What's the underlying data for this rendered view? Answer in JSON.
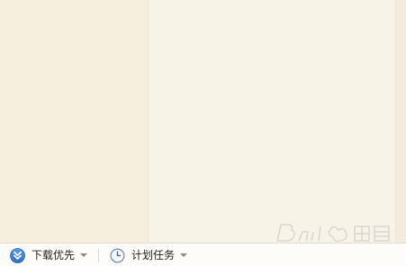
{
  "statusbar": {
    "download_priority": {
      "label": "下载优先",
      "icon": "double-chevron-down-icon"
    },
    "scheduled_task": {
      "label": "计划任务",
      "icon": "clock-icon"
    }
  },
  "watermark": {
    "icon": "baidu-jingyan-watermark"
  },
  "colors": {
    "left_pane": "#f7efde",
    "main_pane": "#f8f3e7",
    "statusbar": "#fdfcf9",
    "priority_icon": "#3b7fd6"
  }
}
